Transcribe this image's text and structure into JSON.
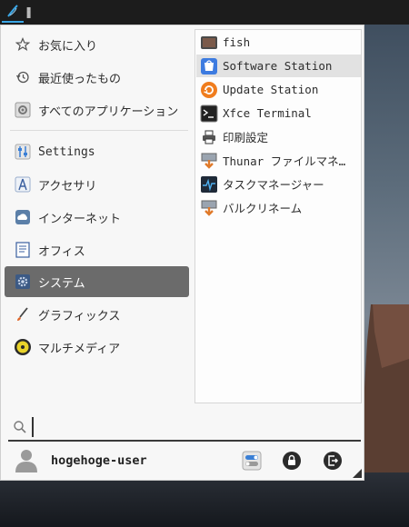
{
  "panel": {
    "launcher_icon": "whisker-menu-icon",
    "separator_icon": "panel-handle-icon"
  },
  "sidebar": {
    "items": [
      {
        "label": "お気に入り",
        "icon": "star-icon"
      },
      {
        "label": "最近使ったもの",
        "icon": "history-icon"
      },
      {
        "label": "すべてのアプリケーション",
        "icon": "all-apps-icon"
      },
      {
        "label": "Settings",
        "icon": "settings-icon"
      },
      {
        "label": "アクセサリ",
        "icon": "accessories-icon"
      },
      {
        "label": "インターネット",
        "icon": "internet-icon"
      },
      {
        "label": "オフィス",
        "icon": "office-icon"
      },
      {
        "label": "システム",
        "icon": "system-icon",
        "active": true
      },
      {
        "label": "グラフィックス",
        "icon": "graphics-icon"
      },
      {
        "label": "マルチメディア",
        "icon": "multimedia-icon"
      }
    ]
  },
  "apps": {
    "items": [
      {
        "label": "fish",
        "icon": "fish-terminal-icon"
      },
      {
        "label": "Software Station",
        "icon": "software-station-icon",
        "hover": true
      },
      {
        "label": "Update Station",
        "icon": "update-station-icon"
      },
      {
        "label": "Xfce Terminal",
        "icon": "terminal-icon"
      },
      {
        "label": "印刷設定",
        "icon": "printer-icon"
      },
      {
        "label": "Thunar ファイルマネ…",
        "icon": "thunar-icon"
      },
      {
        "label": "タスクマネージャー",
        "icon": "task-manager-icon"
      },
      {
        "label": "バルクリネーム",
        "icon": "bulk-rename-icon"
      }
    ]
  },
  "search": {
    "value": "",
    "placeholder": "",
    "icon": "search-icon"
  },
  "user": {
    "name": "hogehoge-user",
    "avatar_icon": "user-avatar-icon",
    "actions": [
      {
        "icon": "settings-toggle-icon"
      },
      {
        "icon": "lock-icon"
      },
      {
        "icon": "logout-icon"
      }
    ]
  },
  "colors": {
    "active_category": "#6b6b6b",
    "hover_app": "#e2e2e2",
    "panel_accent": "#3aa6e6"
  }
}
